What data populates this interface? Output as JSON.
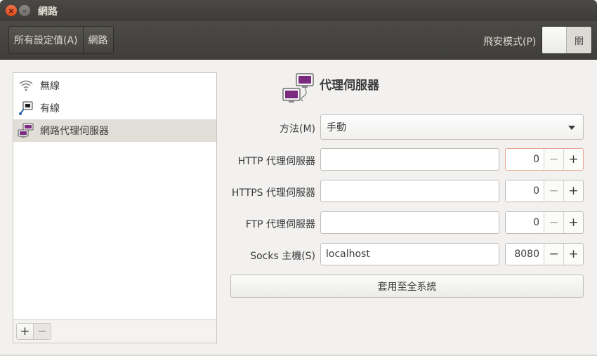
{
  "window": {
    "title": "網路",
    "close_symbol": "×",
    "minimize_symbol": "–"
  },
  "toolbar": {
    "breadcrumb": [
      "所有設定值(A)",
      "網路"
    ],
    "airplane_mode_label": "飛安模式(P)",
    "airplane_mode_state": "關"
  },
  "sidebar": {
    "items": [
      {
        "label": "無線",
        "icon": "wifi-icon",
        "selected": false
      },
      {
        "label": "有線",
        "icon": "wired-network-icon",
        "selected": false
      },
      {
        "label": "網路代理伺服器",
        "icon": "network-proxy-icon",
        "selected": true
      }
    ],
    "add_symbol": "+",
    "remove_symbol": "−"
  },
  "panel": {
    "icon": "network-proxy-icon",
    "title": "代理伺服器",
    "method_label": "方法(M)",
    "method_value": "手動",
    "rows": [
      {
        "label": "HTTP 代理伺服器",
        "host": "",
        "port": "0"
      },
      {
        "label": "HTTPS 代理伺服器",
        "host": "",
        "port": "0"
      },
      {
        "label": "FTP 代理伺服器",
        "host": "",
        "port": "0"
      },
      {
        "label": "Socks 主機(S)",
        "host": "localhost",
        "port": "8080"
      }
    ],
    "minus_symbol": "−",
    "plus_symbol": "+",
    "apply_label": "套用至全系統"
  },
  "colors": {
    "titlebar": "#3d3c38",
    "accent_focus": "#e9a490",
    "close_button": "#dd4814",
    "proxy_icon_purple": "#7b2b7f"
  }
}
